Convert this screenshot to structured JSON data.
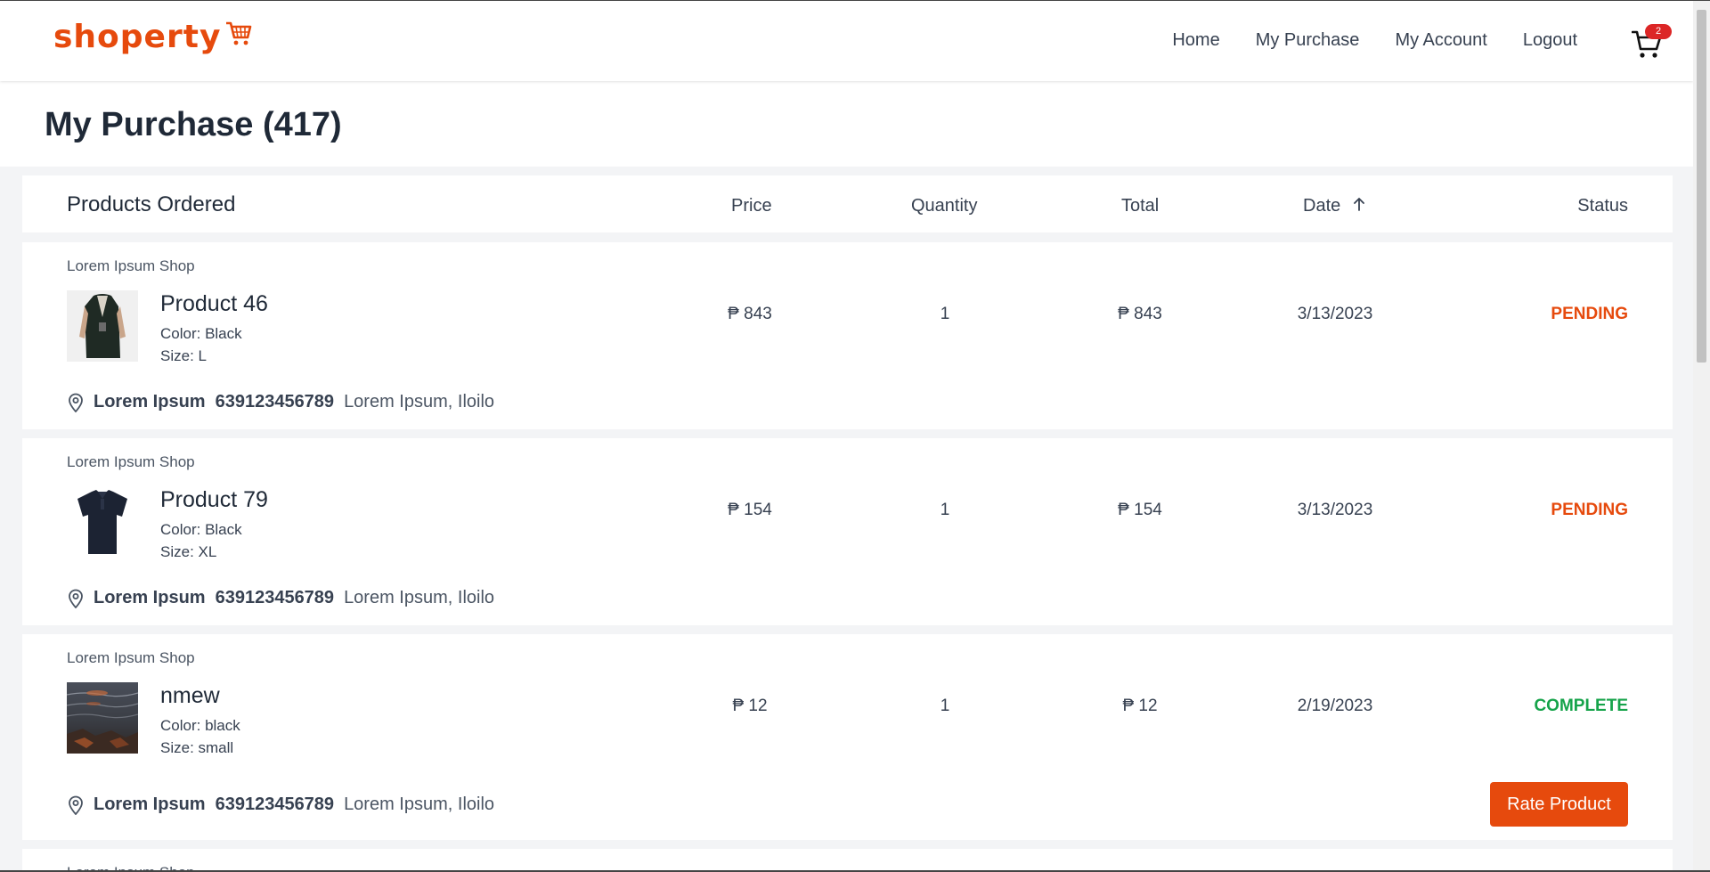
{
  "brand": {
    "name": "shoperty",
    "accent": "#e64a0d"
  },
  "nav": {
    "home": "Home",
    "purchase": "My Purchase",
    "account": "My Account",
    "logout": "Logout",
    "cart_count": "2"
  },
  "page": {
    "title": "My Purchase (417)"
  },
  "table_header": {
    "products": "Products Ordered",
    "price": "Price",
    "quantity": "Quantity",
    "total": "Total",
    "date": "Date",
    "status": "Status",
    "date_sort_icon": "arrow-up-icon"
  },
  "orders": [
    {
      "shop": "Lorem Ipsum Shop",
      "name": "Product 46",
      "color": "Color: Black",
      "size": "Size: L",
      "price": "₱ 843",
      "quantity": "1",
      "total": "₱ 843",
      "date": "3/13/2023",
      "status": "PENDING",
      "address_name": "Lorem Ipsum",
      "phone": "639123456789",
      "location": "Lorem Ipsum, Iloilo"
    },
    {
      "shop": "Lorem Ipsum Shop",
      "name": "Product 79",
      "color": "Color: Black",
      "size": "Size: XL",
      "price": "₱ 154",
      "quantity": "1",
      "total": "₱ 154",
      "date": "3/13/2023",
      "status": "PENDING",
      "address_name": "Lorem Ipsum",
      "phone": "639123456789",
      "location": "Lorem Ipsum, Iloilo"
    },
    {
      "shop": "Lorem Ipsum Shop",
      "name": "nmew",
      "color": "Color: black",
      "size": "Size: small",
      "price": "₱ 12",
      "quantity": "1",
      "total": "₱ 12",
      "date": "2/19/2023",
      "status": "COMPLETE",
      "address_name": "Lorem Ipsum",
      "phone": "639123456789",
      "location": "Lorem Ipsum, Iloilo",
      "action": "Rate Product"
    },
    {
      "shop": "Lorem Ipsum Shop"
    }
  ],
  "status_colors": {
    "pending": "#e64a0d",
    "complete": "#16a34a"
  }
}
